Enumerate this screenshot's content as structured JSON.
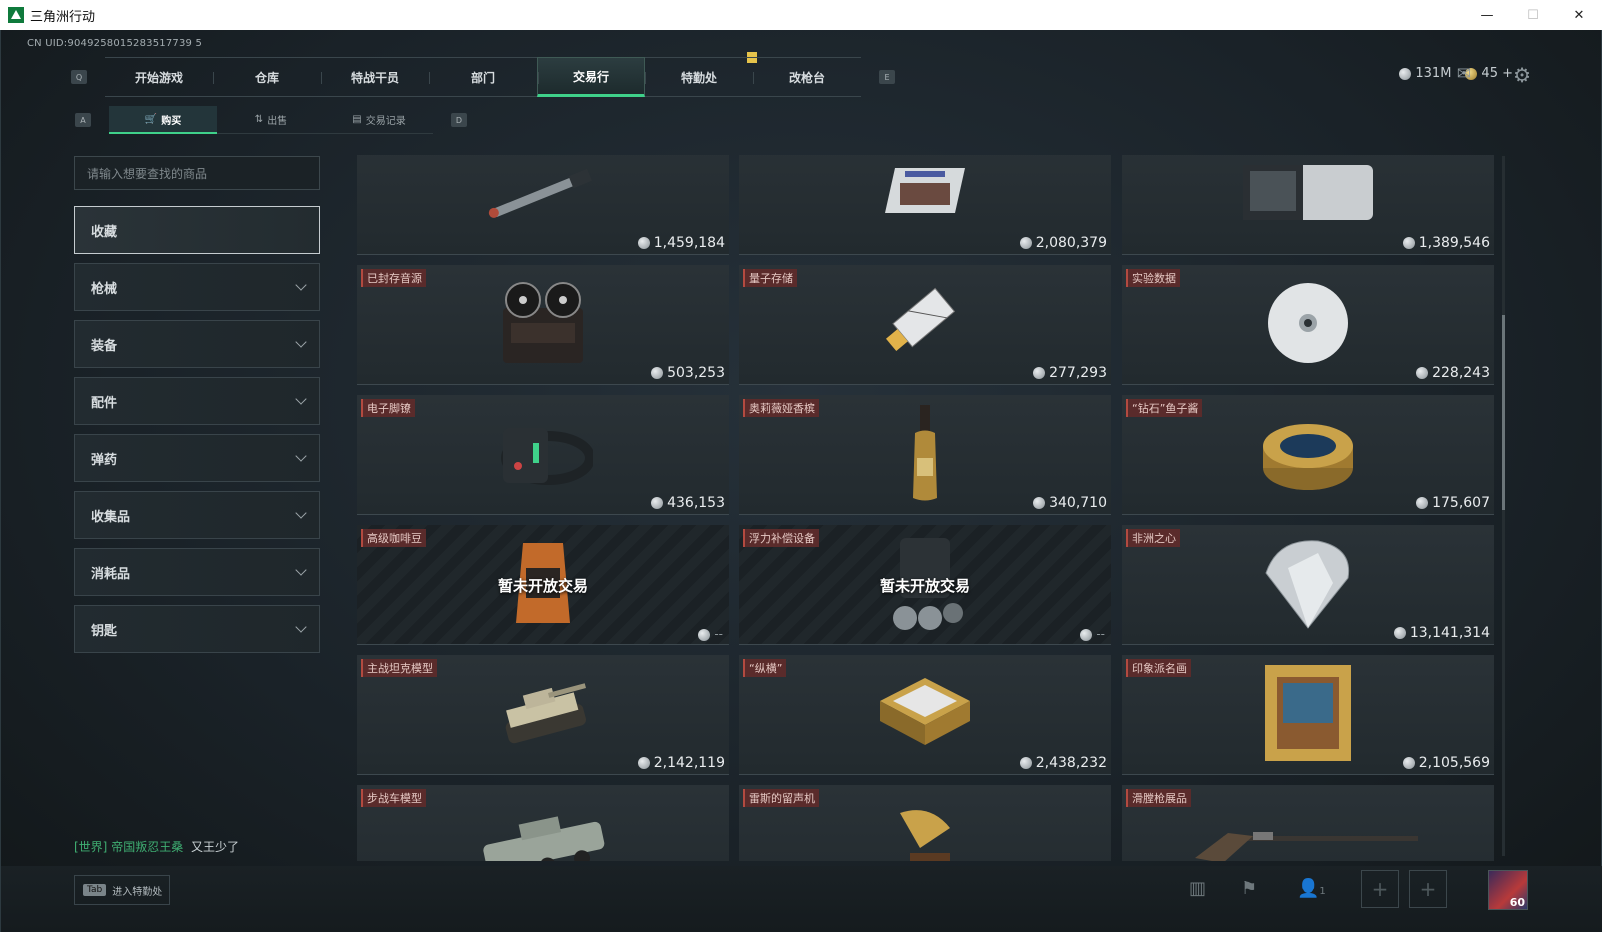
{
  "window": {
    "title": "三角洲行动",
    "minimize": "—",
    "maximize": "☐",
    "close": "✕"
  },
  "uid": "CN UID:9049258015283517739 5",
  "nav": {
    "left_key": "Q",
    "right_key": "E",
    "tabs": [
      "开始游戏",
      "仓库",
      "特战干员",
      "部门",
      "交易行",
      "特勤处",
      "改枪台"
    ],
    "active": 4
  },
  "currency": {
    "silver": "131M",
    "gold": "45 +"
  },
  "subnav": {
    "left_key": "A",
    "right_key": "D",
    "tabs": [
      "购买",
      "出售",
      "交易记录"
    ],
    "icons": [
      "🛒",
      "⇅",
      "▤"
    ]
  },
  "search": {
    "placeholder": "请输入想要查找的商品"
  },
  "categories": [
    "收藏",
    "枪械",
    "装备",
    "配件",
    "弹药",
    "收集品",
    "消耗品",
    "钥匙"
  ],
  "items": [
    {
      "name": "",
      "price": "1,459,184",
      "art": "missile"
    },
    {
      "name": "",
      "price": "2,080,379",
      "art": "device"
    },
    {
      "name": "",
      "price": "1,389,546",
      "art": "server"
    },
    {
      "name": "已封存音源",
      "price": "503,253",
      "art": "reel"
    },
    {
      "name": "量子存储",
      "price": "277,293",
      "art": "usb"
    },
    {
      "name": "实验数据",
      "price": "228,243",
      "art": "disc"
    },
    {
      "name": "电子脚镣",
      "price": "436,153",
      "art": "anklet"
    },
    {
      "name": "奥莉薇娅香槟",
      "price": "340,710",
      "art": "bottle"
    },
    {
      "name": "“钻石”鱼子酱",
      "price": "175,607",
      "art": "caviar"
    },
    {
      "name": "高级咖啡豆",
      "price": "",
      "locked": "暂未开放交易",
      "art": "coffee"
    },
    {
      "name": "浮力补偿设备",
      "price": "",
      "locked": "暂未开放交易",
      "art": "bcd"
    },
    {
      "name": "非洲之心",
      "price": "13,141,314",
      "art": "diamond"
    },
    {
      "name": "主战坦克模型",
      "price": "2,142,119",
      "art": "tank"
    },
    {
      "name": "“纵横”",
      "price": "2,438,232",
      "art": "chess"
    },
    {
      "name": "印象派名画",
      "price": "2,105,569",
      "art": "painting"
    },
    {
      "name": "步战车模型",
      "price": "",
      "art": "ifv"
    },
    {
      "name": "雷斯的留声机",
      "price": "",
      "art": "gramophone"
    },
    {
      "name": "滑膛枪展品",
      "price": "",
      "art": "musket"
    }
  ],
  "locked_price": "--",
  "chat": {
    "channel": "[世界]",
    "name": "帝国叛忍王桑",
    "message": "又王少了"
  },
  "bottom": {
    "tab_key": "Tab",
    "tab_label": "进入特勤处",
    "team_count": "1",
    "level": "60"
  }
}
